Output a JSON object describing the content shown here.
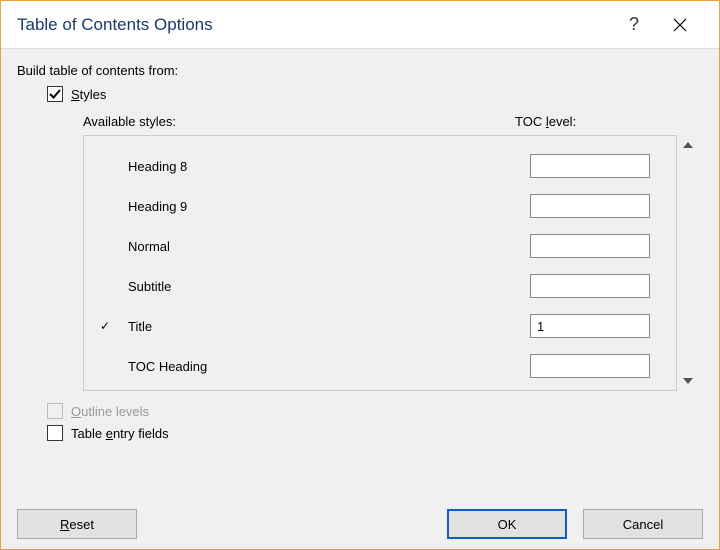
{
  "titlebar": {
    "title": "Table of Contents Options",
    "help_tooltip": "?",
    "close_tooltip": "Close"
  },
  "labels": {
    "build_from": "Build table of contents from:",
    "styles": "tyles",
    "styles_access": "S",
    "available_styles": "Available styles:",
    "toc_level": "TOC ",
    "toc_level_access": "l",
    "toc_level_suffix": "evel:",
    "outline_levels": "utline levels",
    "outline_access": "O",
    "table_entry_fields": "Table ",
    "table_entry_access": "e",
    "table_entry_suffix": "ntry fields"
  },
  "styles_list": [
    {
      "name": "Heading 8",
      "checked": false,
      "level": ""
    },
    {
      "name": "Heading 9",
      "checked": false,
      "level": ""
    },
    {
      "name": "Normal",
      "checked": false,
      "level": ""
    },
    {
      "name": "Subtitle",
      "checked": false,
      "level": ""
    },
    {
      "name": "Title",
      "checked": true,
      "level": "1"
    },
    {
      "name": "TOC Heading",
      "checked": false,
      "level": ""
    }
  ],
  "checkboxes": {
    "styles": true,
    "outline_levels": false,
    "table_entry_fields": false,
    "outline_disabled": true
  },
  "buttons": {
    "reset": "eset",
    "reset_access": "R",
    "ok": "OK",
    "cancel": "Cancel"
  }
}
